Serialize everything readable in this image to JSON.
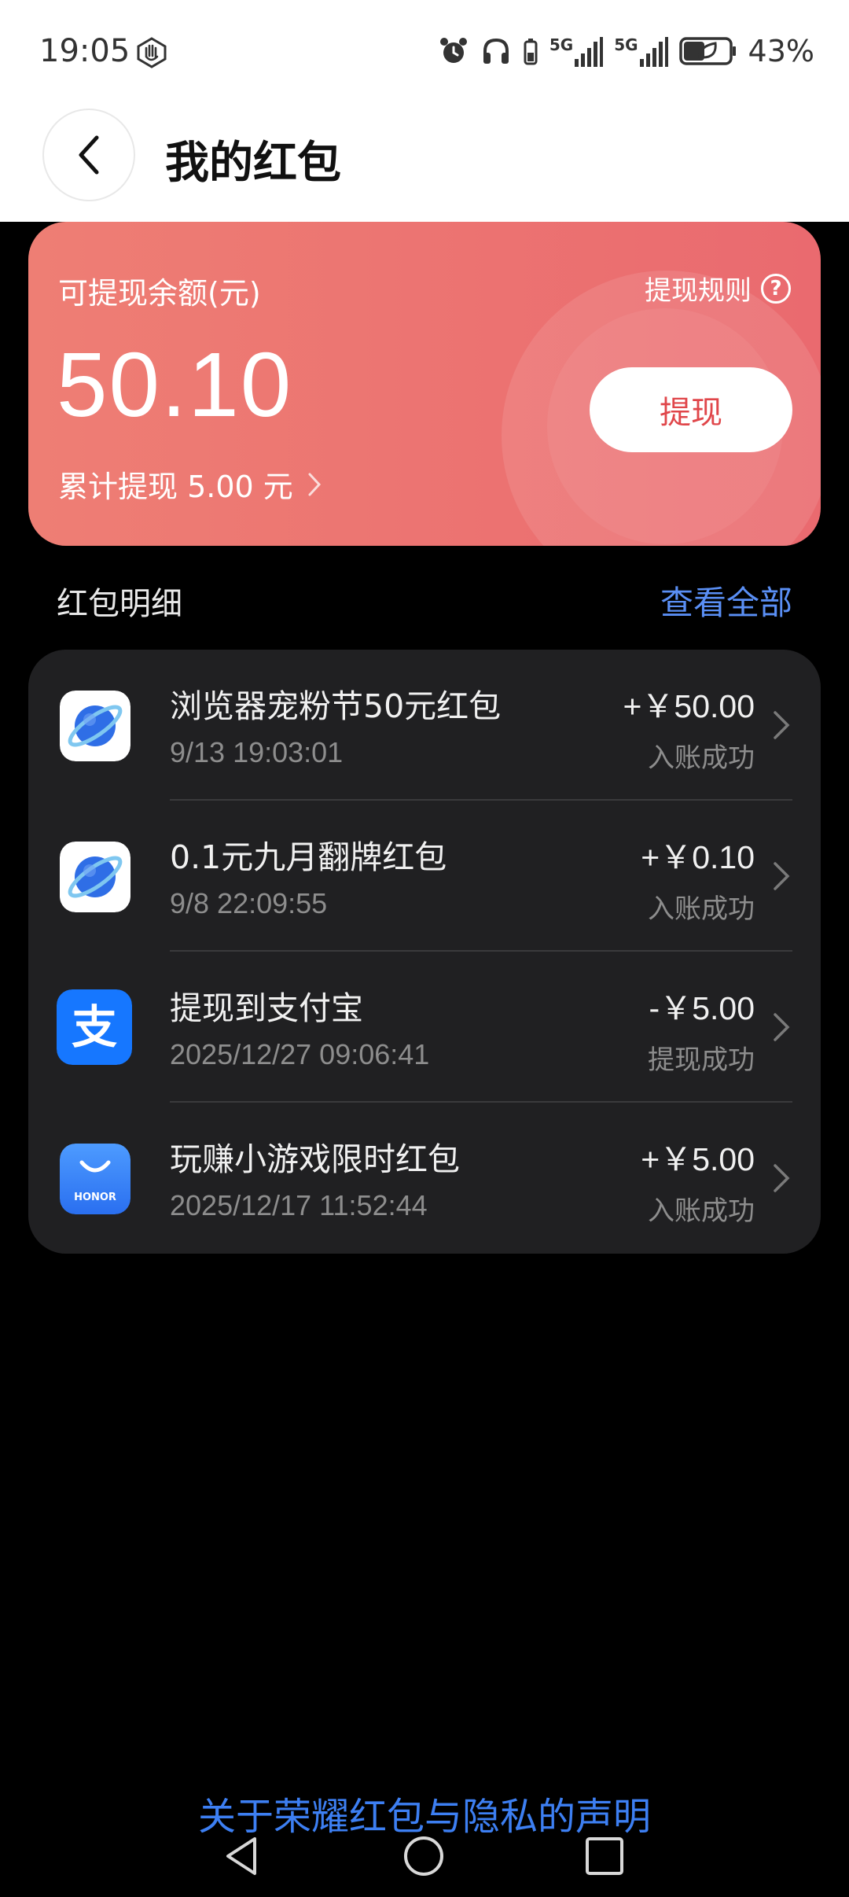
{
  "status_bar": {
    "time": "19:05",
    "battery_percent": "43%",
    "battery_level": 43,
    "signal_1_label": "5G",
    "signal_2_label": "5G"
  },
  "header": {
    "title": "我的红包"
  },
  "balance_card": {
    "label": "可提现余额(元)",
    "rules_label": "提现规则",
    "help_symbol": "?",
    "balance": "50.10",
    "withdraw_label": "提现",
    "cumulative_label": "累计提现 5.00 元",
    "colors": {
      "gradient_start": "#ee7e74",
      "gradient_end": "#ea6a6f",
      "button_text": "#e0464a"
    }
  },
  "section": {
    "title": "红包明细",
    "view_all_label": "查看全部"
  },
  "records": [
    {
      "name": "浏览器宠粉节50元红包",
      "time": "9/13 19:03:01",
      "amount": "+￥50.00",
      "status": "入账成功",
      "icon": "browser-icon"
    },
    {
      "name": "0.1元九月翻牌红包",
      "time": "9/8 22:09:55",
      "amount": "+￥0.10",
      "status": "入账成功",
      "icon": "browser-icon"
    },
    {
      "name": "提现到支付宝",
      "time": "2025/12/27 09:06:41",
      "amount": "-￥5.00",
      "status": "提现成功",
      "icon": "alipay-icon",
      "icon_glyph": "支"
    },
    {
      "name": "玩赚小游戏限时红包",
      "time": "2025/12/17 11:52:44",
      "amount": "+￥5.00",
      "status": "入账成功",
      "icon": "honor-store-icon",
      "icon_text": "HONOR"
    }
  ],
  "footer": {
    "privacy_link": "关于荣耀红包与隐私的声明"
  },
  "nav_bar": {
    "buttons": [
      "back-nav-icon",
      "home-nav-icon",
      "recents-nav-icon"
    ]
  },
  "colors": {
    "link_blue": "#5a8ff5",
    "list_background": "#202022",
    "page_background": "#000000"
  }
}
